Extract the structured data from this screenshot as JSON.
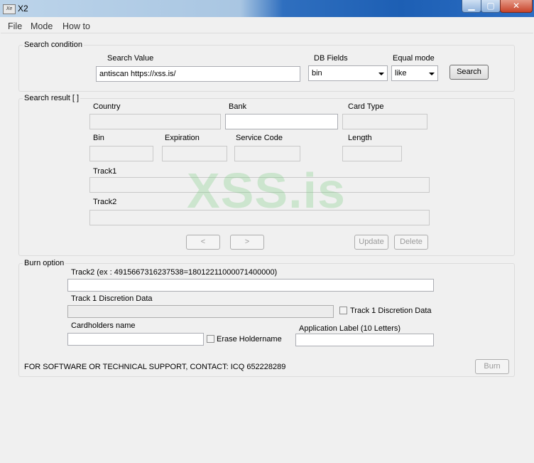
{
  "window": {
    "title": "X2",
    "app_icon": "Xe",
    "minimize": "▁",
    "maximize": "▢",
    "close": "✕"
  },
  "menu": {
    "items": [
      "File",
      "Mode",
      "How to"
    ]
  },
  "search_condition": {
    "group_label": "Search condition",
    "search_value_label": "Search Value",
    "search_value": "antiscan https://xss.is/",
    "db_fields_label": "DB Fields",
    "db_field_selected": "bin",
    "equal_mode_label": "Equal mode",
    "equal_mode_selected": "like",
    "search_button": "Search"
  },
  "search_result": {
    "group_label": "Search result [ ]",
    "country_label": "Country",
    "bank_label": "Bank",
    "card_type_label": "Card Type",
    "bin_label": "Bin",
    "expiration_label": "Expiration",
    "service_code_label": "Service Code",
    "length_label": "Length",
    "track1_label": "Track1",
    "track2_label": "Track2",
    "prev_button": "<",
    "next_button": ">",
    "update_button": "Update",
    "delete_button": "Delete",
    "watermark": "XSS.is"
  },
  "burn_option": {
    "group_label": "Burn option",
    "track2_label": "Track2 (ex : 4915667316237538=18012211000071400000)",
    "track1_discretion_label": "Track 1 Discretion Data",
    "track1_discretion_checkbox_label": "Track 1 Discretion Data",
    "cardholders_label": "Cardholders name",
    "erase_holdername_label": "Erase Holdername",
    "application_label_label": "Application Label (10 Letters)",
    "support_text": "FOR SOFTWARE OR TECHNICAL SUPPORT, CONTACT: ICQ 652228289",
    "burn_button": "Burn"
  }
}
